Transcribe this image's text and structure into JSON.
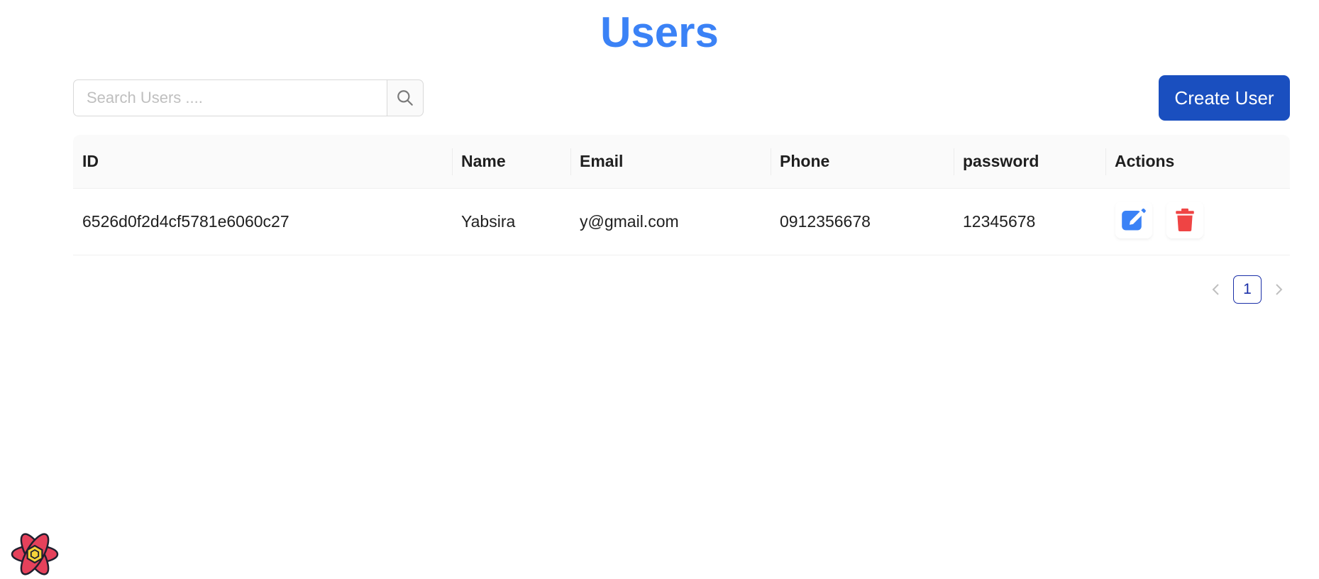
{
  "header": {
    "title": "Users"
  },
  "search": {
    "placeholder": "Search Users ...."
  },
  "toolbar": {
    "create_label": "Create User"
  },
  "table": {
    "columns": [
      "ID",
      "Name",
      "Email",
      "Phone",
      "password",
      "Actions"
    ],
    "rows": [
      {
        "id": "6526d0f2d4cf5781e6060c27",
        "name": "Yabsira",
        "email": "y@gmail.com",
        "phone": "0912356678",
        "password": "12345678"
      }
    ]
  },
  "pagination": {
    "current_page": "1"
  },
  "icons": {
    "search": "search-icon",
    "edit": "edit-icon",
    "delete": "trash-icon",
    "prev": "chevron-left-icon",
    "next": "chevron-right-icon",
    "devtools": "react-atom-icon"
  },
  "colors": {
    "title": "#3b82f6",
    "primary_button": "#1a4fbf",
    "edit_icon": "#3b82f6",
    "delete_icon": "#ef4444",
    "active_page": "#1a2fa8"
  }
}
